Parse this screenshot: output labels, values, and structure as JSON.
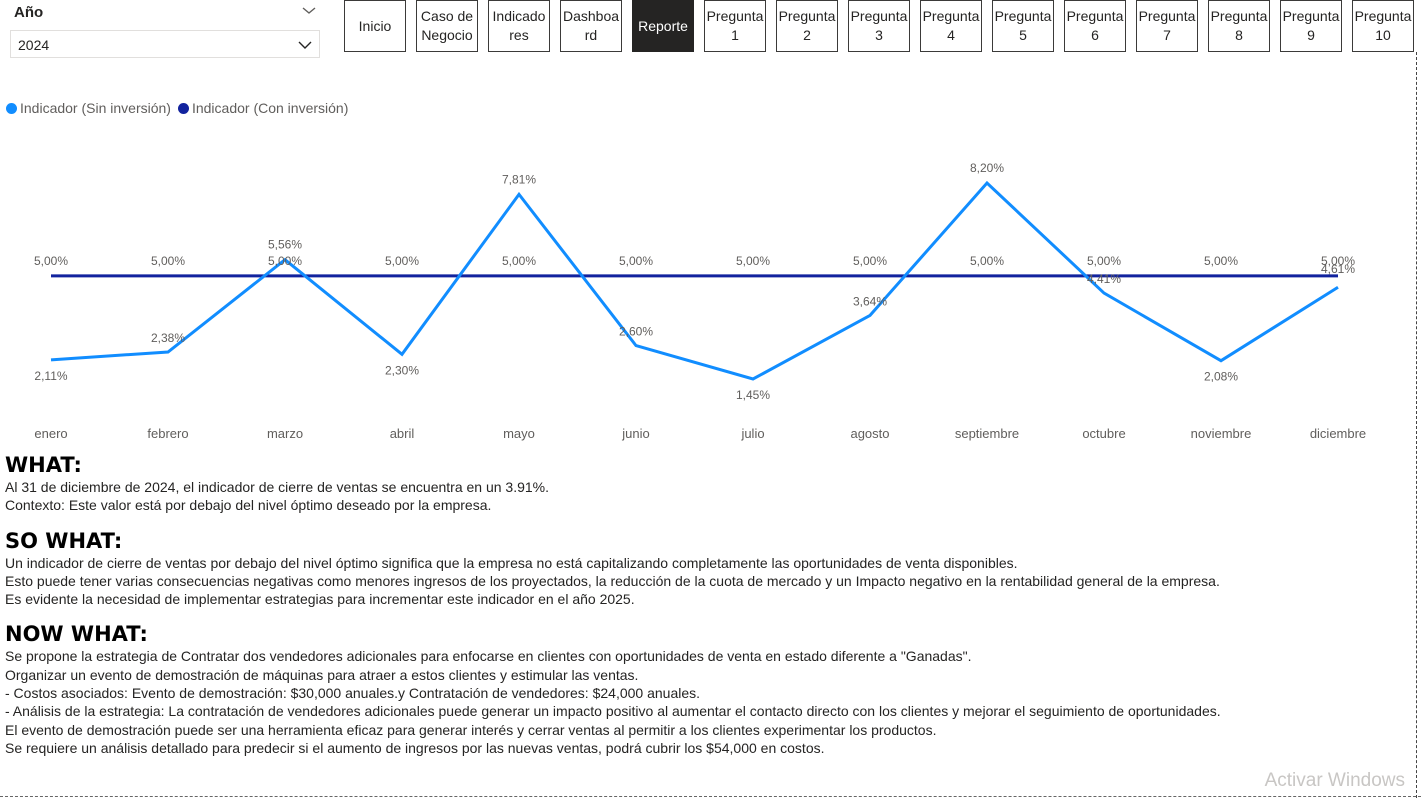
{
  "slicer": {
    "title": "Año",
    "value": "2024"
  },
  "nav": [
    {
      "label": "Inicio",
      "active": false
    },
    {
      "label": "Caso de Negocio",
      "active": false
    },
    {
      "label": "Indicado res",
      "active": false
    },
    {
      "label": "Dashboa rd",
      "active": false
    },
    {
      "label": "Reporte",
      "active": true
    },
    {
      "label": "Pregunta 1",
      "active": false
    },
    {
      "label": "Pregunta 2",
      "active": false
    },
    {
      "label": "Pregunta 3",
      "active": false
    },
    {
      "label": "Pregunta 4",
      "active": false
    },
    {
      "label": "Pregunta 5",
      "active": false
    },
    {
      "label": "Pregunta 6",
      "active": false
    },
    {
      "label": "Pregunta 7",
      "active": false
    },
    {
      "label": "Pregunta 8",
      "active": false
    },
    {
      "label": "Pregunta 9",
      "active": false
    },
    {
      "label": "Pregunta 10",
      "active": false
    }
  ],
  "colors": {
    "sin_inversion": "#118DFF",
    "con_inversion": "#12239E",
    "active_button": "#252423"
  },
  "chart_data": {
    "type": "line",
    "categories": [
      "enero",
      "febrero",
      "marzo",
      "abril",
      "mayo",
      "junio",
      "julio",
      "agosto",
      "septiembre",
      "octubre",
      "noviembre",
      "diciembre"
    ],
    "series": [
      {
        "name": "Indicador (Sin inversión)",
        "values": [
          2.11,
          2.38,
          5.56,
          2.3,
          7.81,
          2.6,
          1.45,
          3.64,
          8.2,
          4.41,
          2.08,
          4.61
        ],
        "labels": [
          "2,11%",
          "2,38%",
          "5,56%",
          "2,30%",
          "7,81%",
          "2,60%",
          "1,45%",
          "3,64%",
          "8,20%",
          "4,41%",
          "2,08%",
          "4,61%"
        ]
      },
      {
        "name": "Indicador (Con inversión)",
        "values": [
          5.0,
          5.0,
          5.0,
          5.0,
          5.0,
          5.0,
          5.0,
          5.0,
          5.0,
          5.0,
          5.0,
          5.0
        ],
        "labels": [
          "5,00%",
          "5,00%",
          "5,00%",
          "5,00%",
          "5,00%",
          "5,00%",
          "5,00%",
          "5,00%",
          "5,00%",
          "5,00%",
          "5,00%",
          "5,00%"
        ]
      }
    ],
    "legend_position": "top-left",
    "grid": false
  },
  "report": {
    "what": {
      "heading": "WHAT:",
      "lines": [
        "Al 31 de diciembre de 2024, el indicador de cierre de ventas se encuentra en un 3.91%.",
        "Contexto: Este valor está por debajo del nivel óptimo deseado por la empresa."
      ]
    },
    "so_what": {
      "heading": "SO WHAT:",
      "lines": [
        "Un indicador de cierre de ventas por debajo del nivel óptimo significa que la empresa no está capitalizando completamente las oportunidades de venta disponibles.",
        "Esto puede tener varias consecuencias negativas como menores ingresos de los proyectados, la reducción de la cuota de mercado y un Impacto negativo en la rentabilidad general de la empresa.",
        "Es evidente la necesidad de implementar estrategias para incrementar este indicador en el año 2025."
      ]
    },
    "now_what": {
      "heading": "NOW WHAT:",
      "lines": [
        "Se propone la estrategia de Contratar dos vendedores adicionales para enfocarse en clientes con oportunidades de venta en estado diferente a \"Ganadas\".",
        "Organizar un evento de demostración de máquinas para atraer a estos clientes y estimular las ventas.",
        "- Costos asociados: Evento de demostración: $30,000 anuales.y Contratación de vendedores: $24,000 anuales.",
        "- Análisis de la estrategia: La contratación de vendedores adicionales puede generar un impacto positivo al aumentar el contacto directo con los clientes y mejorar el seguimiento de oportunidades.",
        "El evento de demostración puede ser una herramienta eficaz para generar interés y cerrar ventas al permitir a los clientes experimentar los productos.",
        "Se requiere un análisis detallado para predecir si el aumento de ingresos por las nuevas ventas, podrá cubrir los $54,000 en costos."
      ]
    }
  },
  "watermark": "Activar Windows"
}
